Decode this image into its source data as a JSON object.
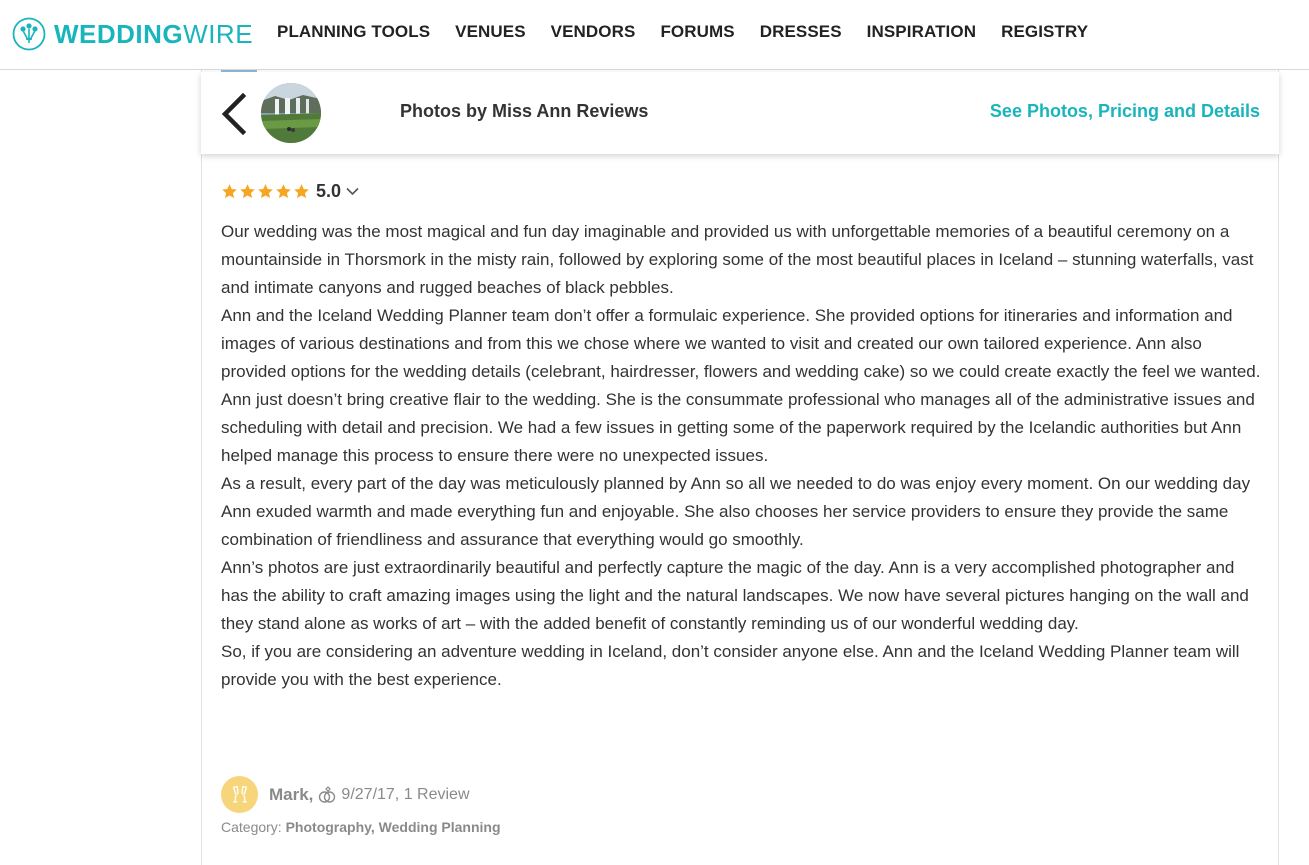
{
  "header": {
    "logo": {
      "text_bold": "WEDDING",
      "text_light": "WIRE",
      "icon": "bouquet-icon"
    },
    "nav": [
      "PLANNING TOOLS",
      "VENUES",
      "VENDORS",
      "FORUMS",
      "DRESSES",
      "INSPIRATION",
      "REGISTRY"
    ]
  },
  "vendor_bar": {
    "back_icon": "chevron-left-icon",
    "thumbnail": "waterfall-photo",
    "name": "Photos by Miss Ann Reviews",
    "cta": "See Photos, Pricing and Details"
  },
  "review": {
    "rating": 5.0,
    "rating_text": "5.0",
    "star_count": 5,
    "paragraphs": [
      "Our wedding was the most magical and fun day imaginable and provided us with unforgettable memories of a beautiful ceremony on a mountainside in Thorsmork in the misty rain, followed by exploring some of the most beautiful places in Iceland – stunning waterfalls, vast and intimate canyons and rugged beaches of black pebbles.",
      "Ann and the Iceland Wedding Planner team don’t offer a formulaic experience. She provided options for itineraries and information and images of various destinations and from this we chose where we wanted to visit and created our own tailored experience. Ann also provided options for the wedding details (celebrant, hairdresser, flowers and wedding cake) so we could create exactly the feel we wanted.",
      "Ann just doesn’t bring creative flair to the wedding. She is the consummate professional who manages all of the administrative issues and scheduling with detail and precision. We had a few issues in getting some of the paperwork required by the Icelandic authorities but Ann helped manage this process to ensure there were no unexpected issues.",
      "As a result, every part of the day was meticulously planned by Ann so all we needed to do was enjoy every moment. On our wedding day Ann exuded warmth and made everything fun and enjoyable. She also chooses her service providers to ensure they provide the same combination of friendliness and assurance that everything would go smoothly.",
      "Ann’s photos are just extraordinarily beautiful and perfectly capture the magic of the day. Ann is a very accomplished photographer and has the ability to craft amazing images using the light and the natural landscapes. We now have several pictures hanging on the wall and they stand alone as works of art – with the added benefit of constantly reminding us of our wonderful wedding day.",
      "So, if you are considering an adventure wedding in Iceland, don’t consider anyone else. Ann and the Iceland Wedding Planner team will provide you with the best experience."
    ],
    "author": {
      "name": "Mark,",
      "meta": "9/27/17, 1 Review",
      "avatar_icon": "champagne-glasses-icon",
      "badge_icon": "wedding-rings-icon"
    },
    "category": {
      "label": "Category:",
      "values": "Photography, Wedding Planning"
    }
  },
  "colors": {
    "brand": "#19b5bc",
    "star": "#f5a623",
    "text": "#333333",
    "muted": "#8a8a8a",
    "avatar_bg": "#f7d57a"
  }
}
